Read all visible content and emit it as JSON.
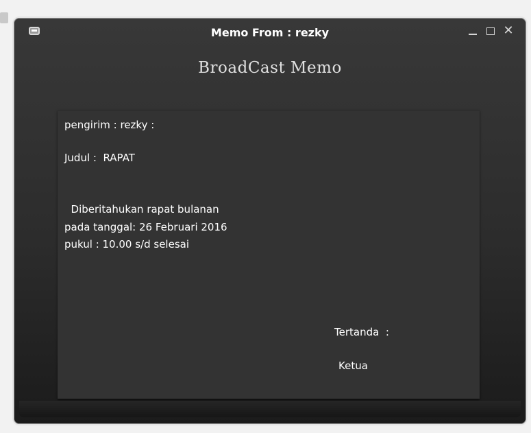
{
  "window": {
    "title": "Memo From  : rezky",
    "controls": {
      "minimize": "minimize-icon",
      "maximize": "maximize-icon",
      "close": "close-icon"
    }
  },
  "heading": "BroadCast Memo",
  "memo": {
    "sender_line": "pengirim : rezky :",
    "subject_line": "Judul :  RAPAT",
    "body_lines": [
      "  Diberitahukan rapat bulanan",
      "pada tanggal: 26 Februari 2016",
      "pukul : 10.00 s/d selesai"
    ],
    "signature_label": "Tertanda  :",
    "signatory": "Ketua"
  },
  "colors": {
    "window_bg": "#2c2c2c",
    "panel_bg": "#333333",
    "text": "#ffffff",
    "frame": "#e6e6e6"
  }
}
